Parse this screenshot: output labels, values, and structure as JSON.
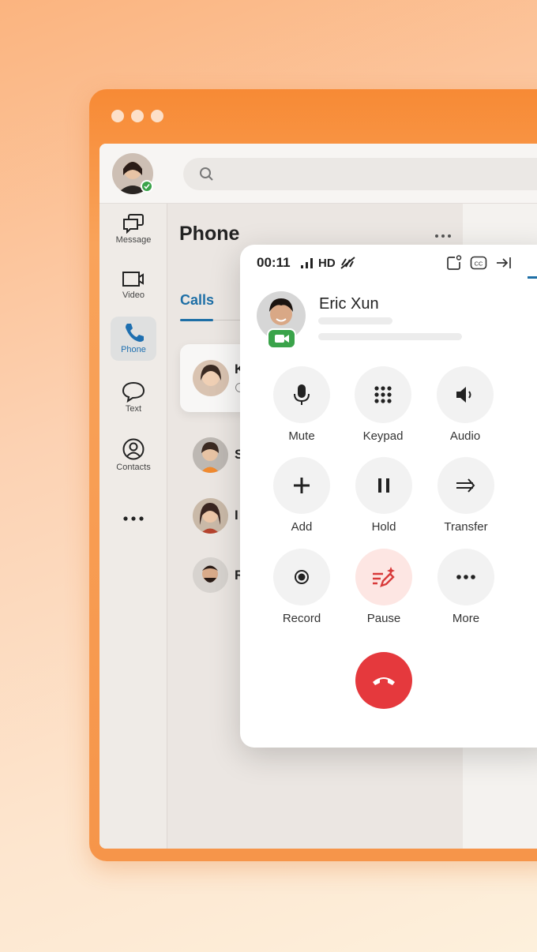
{
  "window": {
    "controls": [
      "close",
      "minimize",
      "maximize"
    ]
  },
  "topbar": {
    "search_icon": "search-icon",
    "status_badge": "available-check"
  },
  "sidebar": {
    "items": [
      {
        "label": "Message",
        "icon": "message-icon"
      },
      {
        "label": "Video",
        "icon": "video-icon"
      },
      {
        "label": "Phone",
        "icon": "phone-icon",
        "active": true
      },
      {
        "label": "Text",
        "icon": "chat-bubble-icon"
      },
      {
        "label": "Contacts",
        "icon": "contact-icon"
      }
    ],
    "more_icon": "more-horizontal-icon"
  },
  "main": {
    "title": "Phone",
    "tabs": [
      {
        "label": "Calls",
        "active": true
      }
    ],
    "calls": [
      {
        "name": "K"
      },
      {
        "name": "S"
      },
      {
        "name": "I"
      },
      {
        "name": "R"
      }
    ]
  },
  "call_panel": {
    "timer": "00:11",
    "quality": "HD",
    "header_icons": [
      "signal-icon",
      "hd-icon",
      "noise-cancel-icon",
      "pop-out-icon",
      "closed-caption-icon",
      "collapse-icon"
    ],
    "caller": {
      "name": "Eric Xun",
      "badge": "video-icon"
    },
    "buttons": [
      {
        "label": "Mute",
        "icon": "microphone-icon"
      },
      {
        "label": "Keypad",
        "icon": "keypad-icon"
      },
      {
        "label": "Audio",
        "icon": "speaker-icon"
      },
      {
        "label": "Add",
        "icon": "plus-icon"
      },
      {
        "label": "Hold",
        "icon": "pause-icon"
      },
      {
        "label": "Transfer",
        "icon": "transfer-icon"
      },
      {
        "label": "Record",
        "icon": "record-icon"
      },
      {
        "label": "Pause",
        "icon": "ai-notes-icon",
        "highlighted": true
      },
      {
        "label": "More",
        "icon": "more-horizontal-icon"
      }
    ],
    "end_call_icon": "end-call-icon",
    "colors": {
      "end_call": "#e5393d",
      "pause_bg": "#fde6e3",
      "accent": "#1e6fa6",
      "online": "#3aa34a"
    }
  }
}
